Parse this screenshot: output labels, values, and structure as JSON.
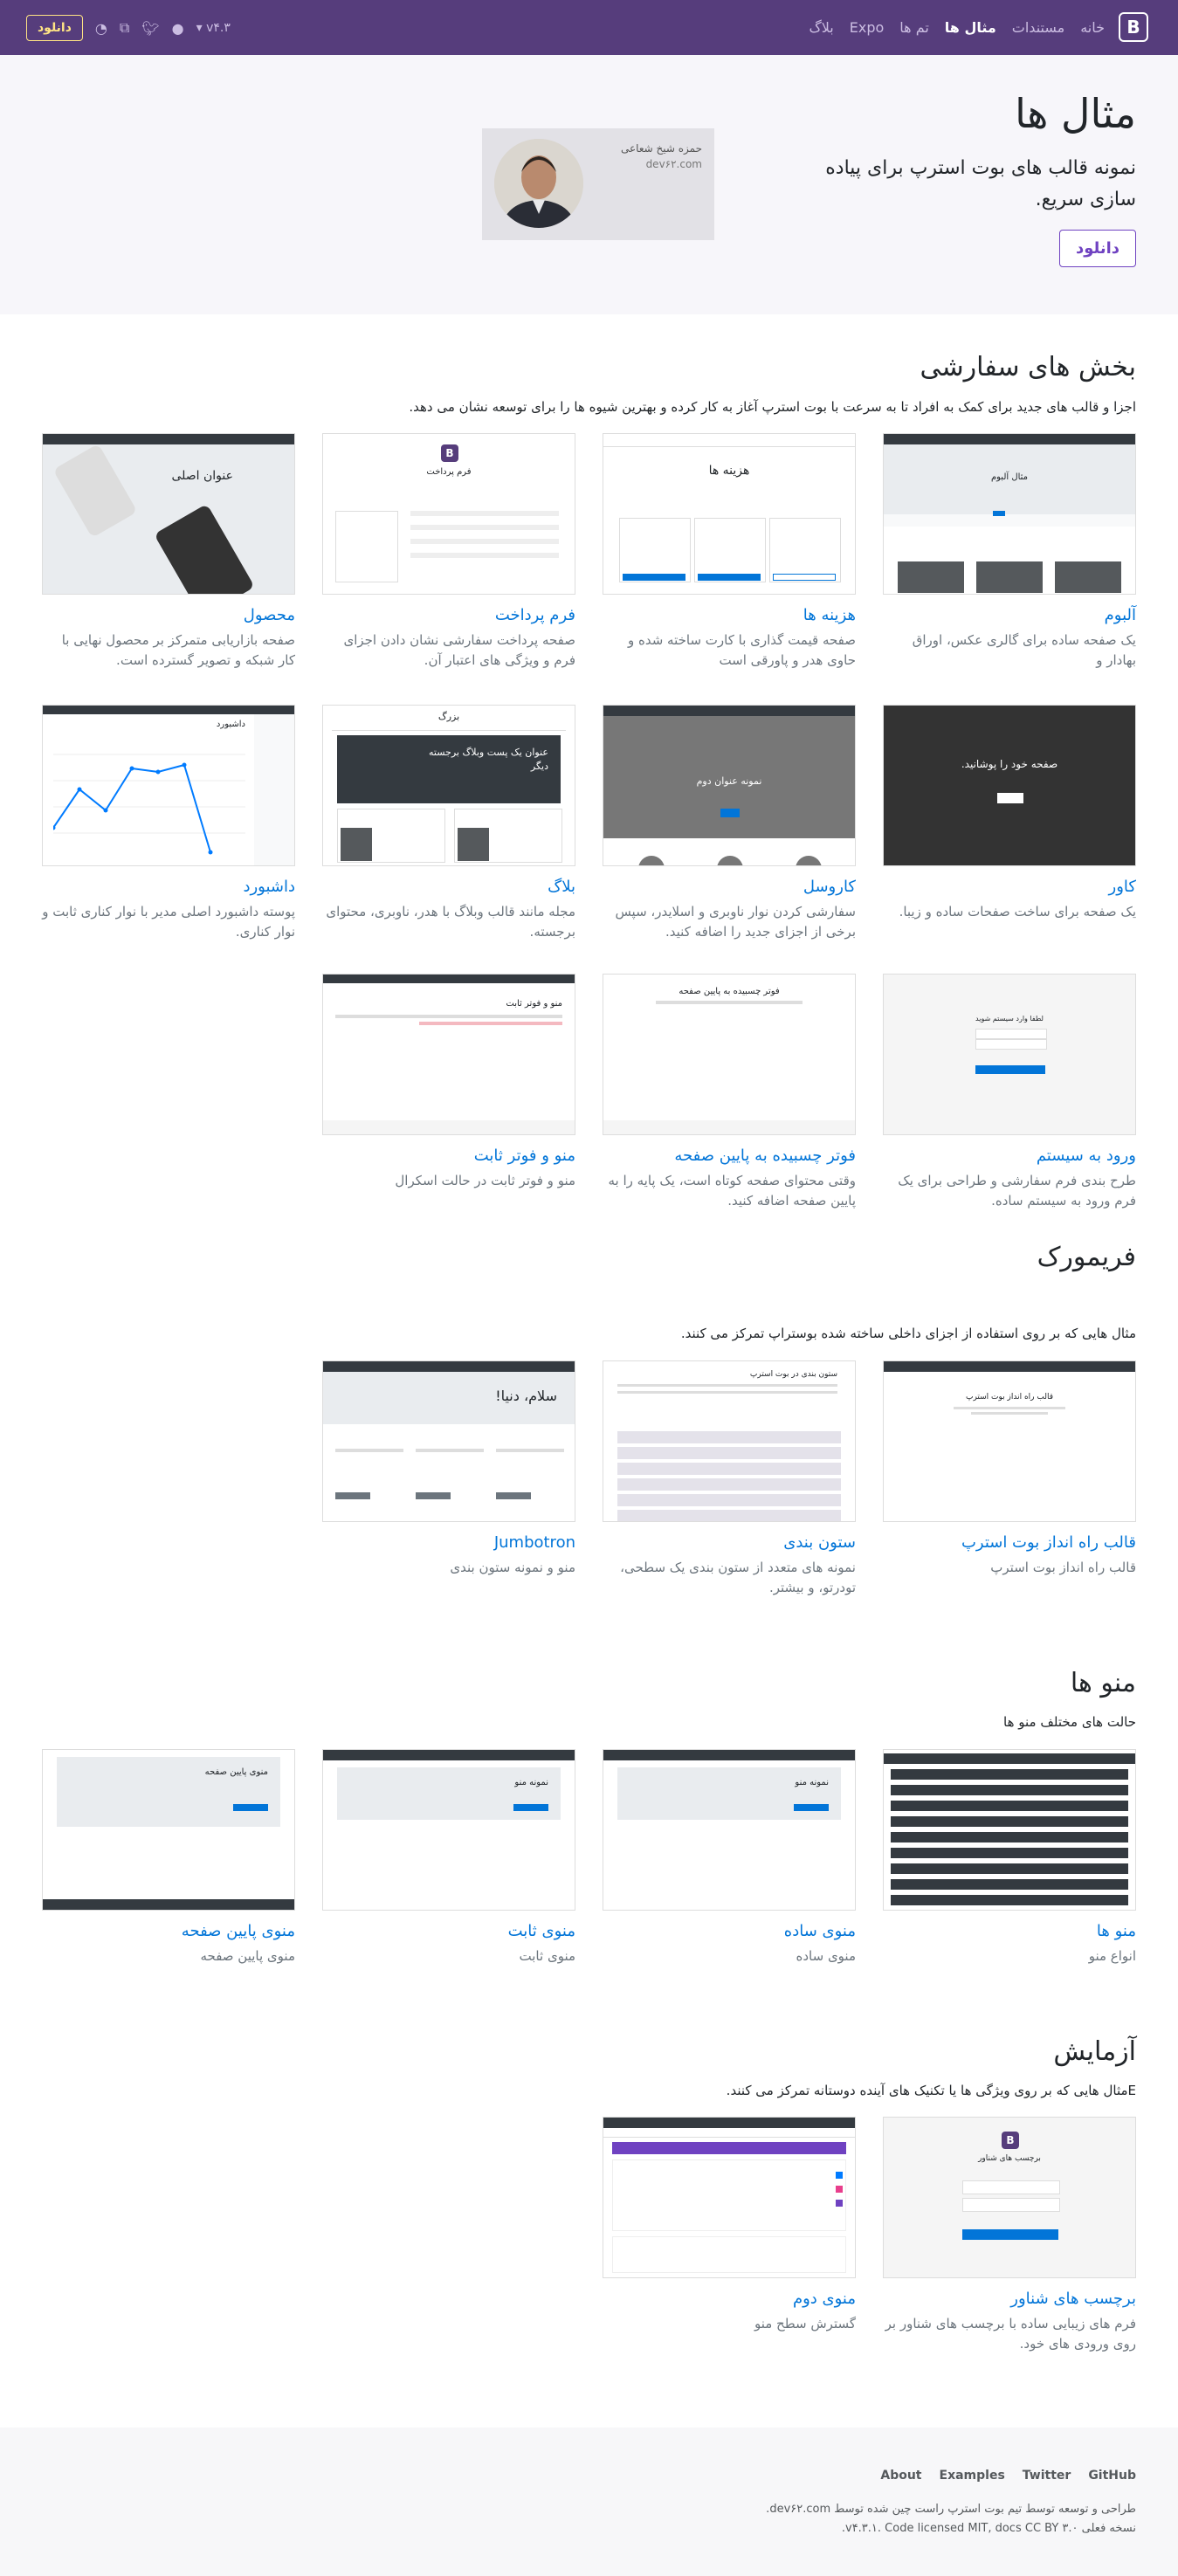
{
  "nav": {
    "brand": "B",
    "links": [
      "خانه",
      "مستندات",
      "مثال ها",
      "تم ها",
      "Expo",
      "بلاگ"
    ],
    "version": "v۴.۳",
    "download": "دانلود"
  },
  "hero": {
    "title": "مثال ها",
    "lead": "نمونه قالب های بوت استرپ برای پیاده سازی سریع.",
    "button": "دانلود",
    "ad_title": "حمزه شیخ شعاعی",
    "ad_sub": "dev۶۲.com"
  },
  "sections": [
    {
      "title": "بخش های سفارشی",
      "desc": "اجزا و قالب های جدید برای کمک به افراد تا به سرعت با بوت استرپ آغاز به کار کرده و بهترین شیوه ها را برای توسعه نشان می دهد.",
      "cards": [
        {
          "title": "آلبوم",
          "desc": "یک صفحه ساده برای گالری عکس، اوراق بهادار و"
        },
        {
          "title": "هزینه ها",
          "desc": "صفحه قیمت گذاری با کارت ساخته شده و حاوی هدر و پاورقی است"
        },
        {
          "title": "فرم پرداخت",
          "desc": "صفحه پرداخت سفارشی نشان دادن اجزای فرم و ویژگی های اعتبار آن."
        },
        {
          "title": "محصول",
          "desc": "صفحه بازاریابی متمرکز بر محصول نهایی با کار شبکه و تصویر گسترده است."
        },
        {
          "title": "کاور",
          "desc": "یک صفحه برای ساخت صفحات ساده و زیبا."
        },
        {
          "title": "کاروسل",
          "desc": "سفارشی کردن نوار ناوبری و اسلایدر، سپس برخی از اجزای جدید را اضافه کنید."
        },
        {
          "title": "بلاگ",
          "desc": "مجله مانند قالب وبلاگ با هدر، ناوبری، محتوای برجسته."
        },
        {
          "title": "داشبورد",
          "desc": "پوسته داشبورد اصلی مدیر با نوار کناری ثابت و نوار کناری."
        },
        {
          "title": "ورود به سیستم",
          "desc": "طرح بندی فرم سفارشی و طراحی برای یک فرم ورود به سیستم ساده."
        },
        {
          "title": "فوتر چسبیده به پایین صفحه",
          "desc": "وقتی محتوای صفحه کوتاه است، یک پایه را به پایین صفحه اضافه کنید."
        },
        {
          "title": "منو و فوتر ثابت",
          "desc": "منو و فوتر ثابت در حالت اسکرال"
        }
      ]
    },
    {
      "title": "فریمورک",
      "desc": "مثال هایی که بر روی استفاده از اجزای داخلی ساخته شده بوستراپ تمرکز می کنند.",
      "cards": [
        {
          "title": "قالب راه انداز بوت استرپ",
          "desc": "قالب راه انداز بوت استرپ"
        },
        {
          "title": "ستون بندی",
          "desc": "نمونه های متعدد از ستون بندی یک سطحی، تودرتو، و بیشتر."
        },
        {
          "title": "Jumbotron",
          "desc": "منو و نمونه ستون بندی"
        }
      ]
    },
    {
      "title": "منو ها",
      "desc": "حالت های مختلف منو ها",
      "cards": [
        {
          "title": "منو ها",
          "desc": "انواع منو"
        },
        {
          "title": "منوی ساده",
          "desc": "منوی ساده"
        },
        {
          "title": "منوی ثابت",
          "desc": "منوی ثابت"
        },
        {
          "title": "منوی پایین صفحه",
          "desc": "منوی پایین صفحه"
        }
      ]
    },
    {
      "title": "آزمایش",
      "desc": "Eمثال هایی که بر روی ویژگی ها یا تکنیک های آینده دوستانه تمرکز می کنند.",
      "cards": [
        {
          "title": "برچسب های شناور",
          "desc": "فرم های زیبایی ساده با برچسب های شناور بر روی ورودی های خود."
        },
        {
          "title": "منوی دوم",
          "desc": "گسترش سطح منو"
        }
      ]
    }
  ],
  "thumbs": {
    "album_heading": "مثال آلبوم",
    "pricing_heading": "هزینه ها",
    "checkout_heading": "فرم پرداخت",
    "product_heading": "عنوان اصلی",
    "cover_heading": "صفحه خود را پوشانید.",
    "carousel_heading": "نمونه عنوان دوم",
    "blog_heading": "عنوان یک پست وبلاگ برجسته دیگر",
    "blog_brand": "بزرگ",
    "dashboard_heading": "داشبورد",
    "signin_heading": "لطفا وارد سیستم شوید",
    "sticky_heading": "فوتر چسبیده به پایین صفحه",
    "navfixed_heading": "منو و فوتر ثابت",
    "starter_heading": "قالب راه انداز بوت استرپ",
    "grid_heading": "ستون بندی در بوت استرپ",
    "jumbo_heading": "سلام، دنیا!",
    "navbar_heading": "نمونه منو",
    "bottom_heading": "منوی پایین صفحه",
    "floating_heading": "برچسب های شناور"
  },
  "footer": {
    "links": [
      "GitHub",
      "Twitter",
      "Examples",
      "About"
    ],
    "line1": "طراحی و توسعه توسط تیم بوت استرپ راست چین شده توسط dev۶۲.com.",
    "line2": "نسخه فعلی v۴.۳.۱. Code licensed MIT, docs CC BY ۳.۰."
  }
}
